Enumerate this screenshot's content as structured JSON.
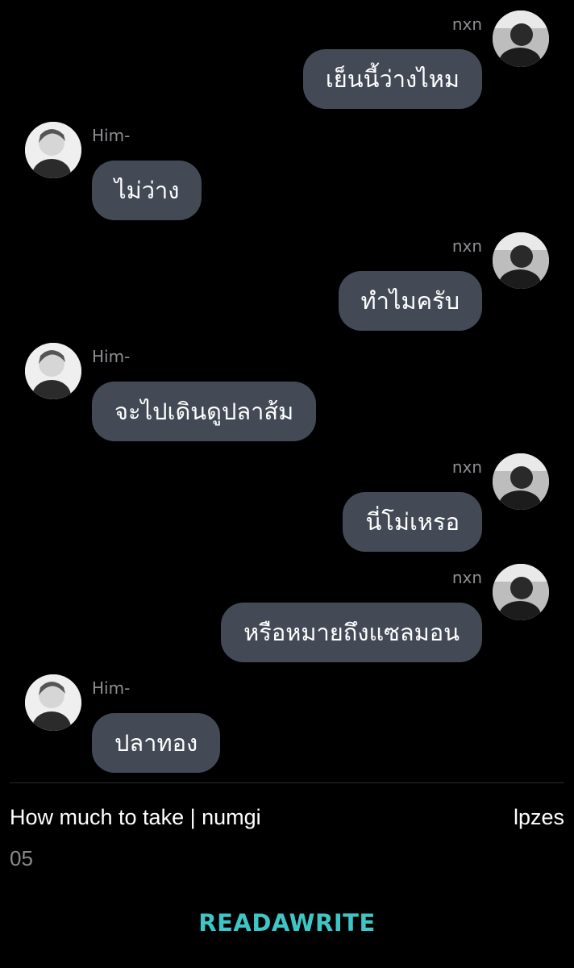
{
  "messages": [
    {
      "side": "right",
      "sender": "nxn",
      "text": "เย็นนี้ว่างไหม"
    },
    {
      "side": "left",
      "sender": "Him-",
      "text": "ไม่ว่าง"
    },
    {
      "side": "right",
      "sender": "nxn",
      "text": "ทำไมครับ"
    },
    {
      "side": "left",
      "sender": "Him-",
      "text": "จะไปเดินดูปลาส้ม"
    },
    {
      "side": "right",
      "sender": "nxn",
      "text": "นี่โม่เหรอ"
    },
    {
      "side": "right",
      "sender": "nxn",
      "text": "หรือหมายถึงแซลมอน"
    },
    {
      "side": "left",
      "sender": "Him-",
      "text": "ปลาทอง"
    }
  ],
  "footer": {
    "title": "How much to take | numgi",
    "author": "lpzes",
    "chapter": "05"
  },
  "logo": {
    "text": "READAWRITE"
  },
  "colors": {
    "background": "#000000",
    "bubble": "#434a56",
    "sender": "#8e8e93",
    "logo": "#3ec6c6"
  }
}
